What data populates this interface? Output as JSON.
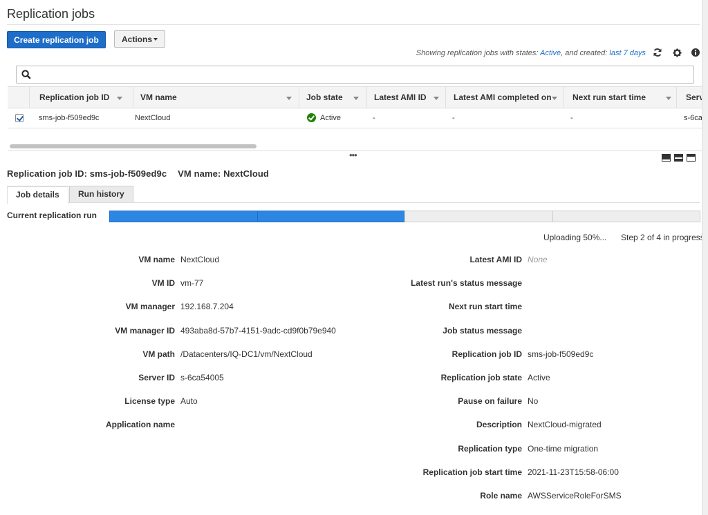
{
  "page": {
    "title": "Replication jobs"
  },
  "toolbar": {
    "create_label": "Create replication job",
    "actions_label": "Actions",
    "filter_prefix": "Showing replication jobs with states: ",
    "filter_state": "Active",
    "filter_mid": ", and created: ",
    "filter_range": "last 7 days"
  },
  "icons": {
    "refresh": "refresh-icon",
    "settings": "gear-icon",
    "info": "info-icon",
    "search": "search-icon",
    "status_active": "check-circle-icon"
  },
  "colors": {
    "primary": "#1e6dc9",
    "active_tab": "#e07b00",
    "progress_fill": "#2d87e2",
    "status_ok": "#1d8102"
  },
  "search": {
    "value": "",
    "placeholder": ""
  },
  "grid": {
    "columns": [
      "Replication job ID",
      "VM name",
      "Job state",
      "Latest AMI ID",
      "Latest AMI completed on",
      "Next run start time",
      "Serv"
    ],
    "rows": [
      {
        "selected": true,
        "job_id": "sms-job-f509ed9c",
        "vm_name": "NextCloud",
        "job_state": "Active",
        "latest_ami_id": "-",
        "latest_ami_completed": "-",
        "next_run": "-",
        "server": "s-6ca"
      }
    ]
  },
  "detail": {
    "job_id_label": "Replication job ID:",
    "job_id": "sms-job-f509ed9c",
    "vm_name_label": "VM name:",
    "vm_name": "NextCloud",
    "tabs": [
      "Job details",
      "Run history"
    ],
    "run_label": "Current replication run",
    "progress": {
      "steps_total": 4,
      "steps_done": 2,
      "percent": 50
    },
    "progress_status": "Uploading 50%...",
    "progress_step": "Step 2 of 4 in progress",
    "left_fields": [
      {
        "label": "VM name",
        "value": "NextCloud"
      },
      {
        "label": "VM ID",
        "value": "vm-77"
      },
      {
        "label": "VM manager",
        "value": "192.168.7.204"
      },
      {
        "label": "VM manager ID",
        "value": "493aba8d-57b7-4151-9adc-cd9f0b79e940"
      },
      {
        "label": "VM path",
        "value": "/Datacenters/IQ-DC1/vm/NextCloud"
      },
      {
        "label": "Server ID",
        "value": "s-6ca54005"
      },
      {
        "label": "License type",
        "value": "Auto"
      },
      {
        "label": "Application name",
        "value": ""
      }
    ],
    "right_fields": [
      {
        "label": "Latest AMI ID",
        "value": "None"
      },
      {
        "label": "Latest run's status message",
        "value": ""
      },
      {
        "label": "Next run start time",
        "value": ""
      },
      {
        "label": "Job status message",
        "value": ""
      },
      {
        "label": "Replication job ID",
        "value": "sms-job-f509ed9c"
      },
      {
        "label": "Replication job state",
        "value": "Active"
      },
      {
        "label": "Pause on failure",
        "value": "No"
      },
      {
        "label": "Description",
        "value": "NextCloud-migrated"
      },
      {
        "label": "Replication type",
        "value": "One-time migration"
      },
      {
        "label": "Replication job start time",
        "value": "2021-11-23T15:58-06:00"
      },
      {
        "label": "Role name",
        "value": "AWSServiceRoleForSMS"
      }
    ]
  }
}
